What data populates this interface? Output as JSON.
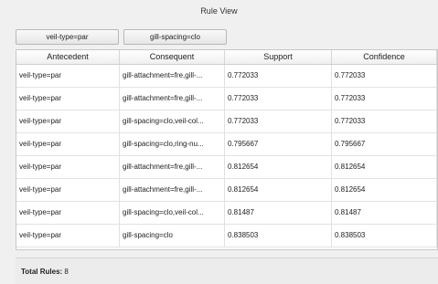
{
  "window": {
    "title": "Rule View"
  },
  "filters": [
    {
      "label": "veil-type=par"
    },
    {
      "label": "gill-spacing=clo"
    }
  ],
  "table": {
    "columns": [
      "Antecedent",
      "Consequent",
      "Support",
      "Confidence"
    ],
    "rows": [
      [
        "veil-type=par",
        "gill-attachment=fre,gill-...",
        "0.772033",
        "0.772033"
      ],
      [
        "veil-type=par",
        "gill-attachment=fre,gill-...",
        "0.772033",
        "0.772033"
      ],
      [
        "veil-type=par",
        "gill-spacing=clo,veil-col...",
        "0.772033",
        "0.772033"
      ],
      [
        "veil-type=par",
        "gill-spacing=clo,ring-nu...",
        "0.795667",
        "0.795667"
      ],
      [
        "veil-type=par",
        "gill-attachment=fre,gill-...",
        "0.812654",
        "0.812654"
      ],
      [
        "veil-type=par",
        "gill-attachment=fre,gill-...",
        "0.812654",
        "0.812654"
      ],
      [
        "veil-type=par",
        "gill-spacing=clo,veil-col...",
        "0.81487",
        "0.81487"
      ],
      [
        "veil-type=par",
        "gill-spacing=clo",
        "0.838503",
        "0.838503"
      ]
    ]
  },
  "footer": {
    "label": "Total Rules:",
    "count": "8"
  }
}
